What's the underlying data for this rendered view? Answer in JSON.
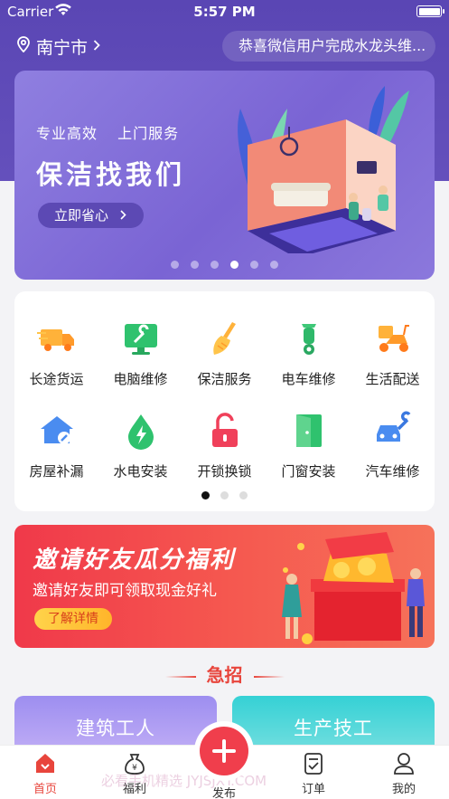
{
  "status_bar": {
    "carrier": "Carrier",
    "time": "5:57 PM"
  },
  "header": {
    "city": "南宁市",
    "notice": "恭喜微信用户完成水龙头维..."
  },
  "banner": {
    "tag1": "专业高效",
    "tag2": "上门服务",
    "title": "保洁找我们",
    "cta": "立即省心",
    "slides_total": 6,
    "active_slide": 4
  },
  "services": {
    "items": [
      {
        "label": "长途货运",
        "icon": "truck-icon"
      },
      {
        "label": "电脑维修",
        "icon": "monitor-wrench-icon"
      },
      {
        "label": "保洁服务",
        "icon": "broom-icon"
      },
      {
        "label": "电车维修",
        "icon": "scooter-icon"
      },
      {
        "label": "生活配送",
        "icon": "delivery-scooter-icon"
      },
      {
        "label": "房屋补漏",
        "icon": "house-repair-icon"
      },
      {
        "label": "水电安装",
        "icon": "water-electric-icon"
      },
      {
        "label": "开锁换锁",
        "icon": "unlock-icon"
      },
      {
        "label": "门窗安装",
        "icon": "door-icon"
      },
      {
        "label": "汽车维修",
        "icon": "car-wrench-icon"
      }
    ],
    "pages_total": 3,
    "active_page": 1
  },
  "invite": {
    "title": "邀请好友瓜分福利",
    "desc": "邀请好友即可领取现金好礼",
    "button": "了解详情"
  },
  "section": {
    "title": "急招"
  },
  "jobs": [
    {
      "title": "建筑工人"
    },
    {
      "title": "生产技工"
    }
  ],
  "watermark": "必看手机精选  JYJSJXY.COM",
  "tabbar": {
    "home": "首页",
    "welfare": "福利",
    "publish": "发布",
    "orders": "订单",
    "mine": "我的",
    "active": "home"
  },
  "colors": {
    "header_purple": "#5a46b4",
    "accent_red": "#e8453c",
    "banner_purple": "#8f7fe0"
  }
}
